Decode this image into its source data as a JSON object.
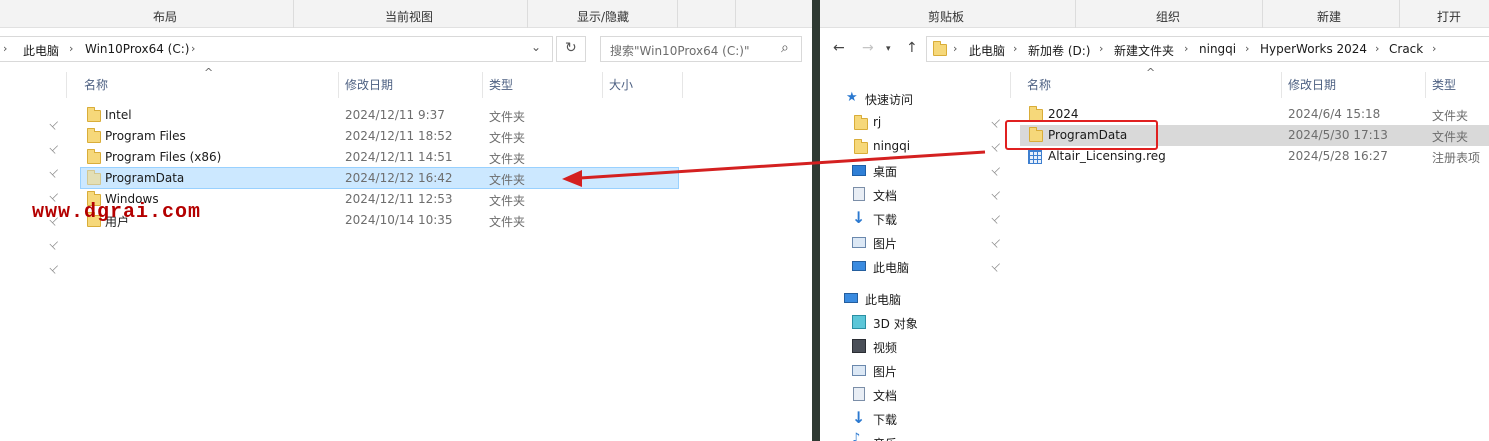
{
  "left": {
    "ribbon": [
      "布局",
      "当前视图",
      "显示/隐藏"
    ],
    "breadcrumb": [
      "此电脑",
      "Win10Prox64 (C:)"
    ],
    "search_placeholder": "搜索\"Win10Prox64 (C:)\"",
    "columns": [
      "名称",
      "修改日期",
      "类型",
      "大小"
    ],
    "files": [
      {
        "name": "Intel",
        "date": "2024/12/11 9:37",
        "type": "文件夹"
      },
      {
        "name": "Program Files",
        "date": "2024/12/11 18:52",
        "type": "文件夹"
      },
      {
        "name": "Program Files (x86)",
        "date": "2024/12/11 14:51",
        "type": "文件夹"
      },
      {
        "name": "ProgramData",
        "date": "2024/12/12 16:42",
        "type": "文件夹"
      },
      {
        "name": "Windows",
        "date": "2024/12/11 12:53",
        "type": "文件夹"
      },
      {
        "name": "用户",
        "date": "2024/10/14 10:35",
        "type": "文件夹"
      }
    ]
  },
  "right": {
    "ribbon": [
      "剪贴板",
      "组织",
      "新建",
      "打开"
    ],
    "breadcrumb": [
      "此电脑",
      "新加卷 (D:)",
      "新建文件夹",
      "ningqi",
      "HyperWorks 2024",
      "Crack"
    ],
    "columns": [
      "名称",
      "修改日期",
      "类型"
    ],
    "files": [
      {
        "name": "2024",
        "date": "2024/6/4 15:18",
        "type": "文件夹"
      },
      {
        "name": "ProgramData",
        "date": "2024/5/30 17:13",
        "type": "文件夹"
      },
      {
        "name": "Altair_Licensing.reg",
        "date": "2024/5/28 16:27",
        "type": "注册表项"
      }
    ],
    "quick_access": {
      "title": "快速访问",
      "items": [
        "rj",
        "ningqi",
        "桌面",
        "文档",
        "下载",
        "图片",
        "此电脑"
      ]
    },
    "this_pc": {
      "title": "此电脑",
      "items": [
        "3D 对象",
        "视频",
        "图片",
        "文档",
        "下载",
        "音乐"
      ]
    }
  },
  "watermark": "www.dgrai.com",
  "colors": {
    "selection": "#cce8ff",
    "highlight_box": "#e02020",
    "arrow": "#d42020"
  }
}
